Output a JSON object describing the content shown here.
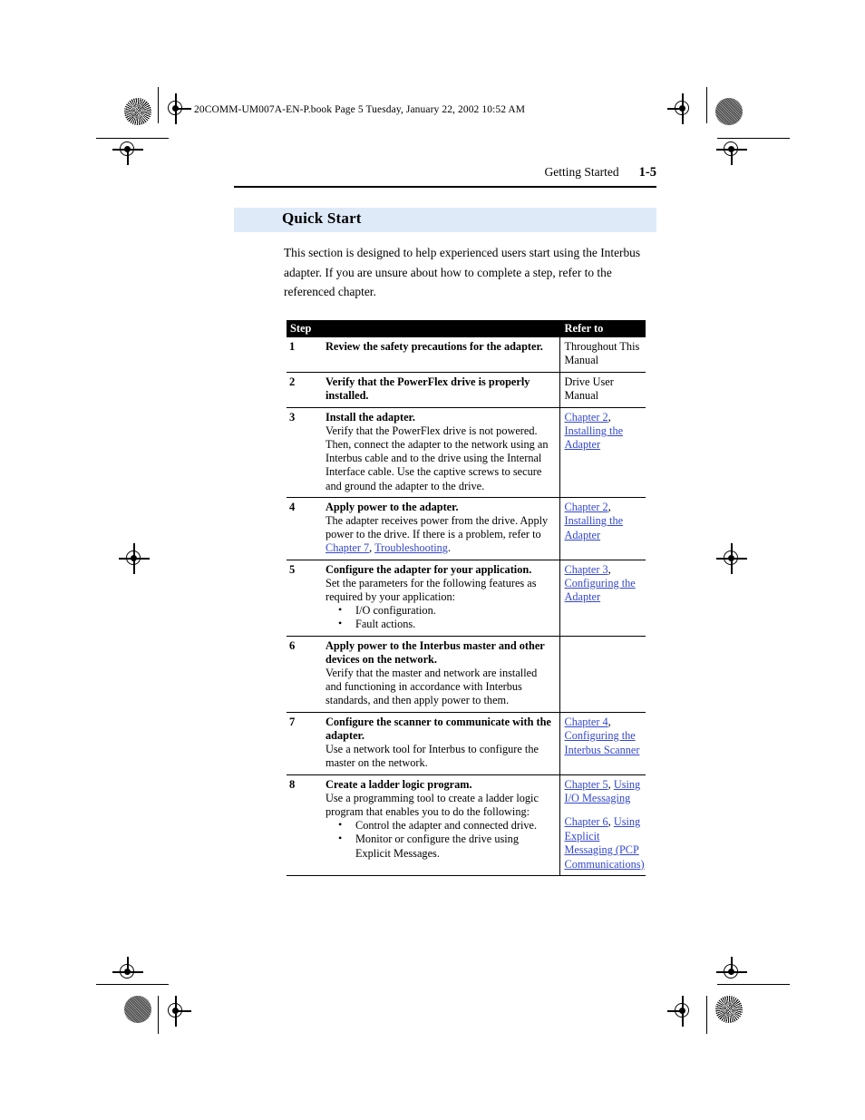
{
  "file_header": "20COMM-UM007A-EN-P.book  Page 5  Tuesday, January 22, 2002  10:52 AM",
  "running_head": {
    "chapter_title": "Getting Started",
    "page_number": "1-5"
  },
  "section": {
    "title": "Quick Start",
    "band_color": "#dfeaf9"
  },
  "intro": "This section is designed to help experienced users start using the Interbus adapter. If you are unsure about how to complete a step, refer to the referenced chapter.",
  "table": {
    "headers": {
      "step": "Step",
      "refer": "Refer to"
    },
    "link_color": "#3347cc",
    "rows": [
      {
        "number": "1",
        "title": "Review the safety precautions for the adapter.",
        "body": "",
        "bullets": [],
        "refer_plain": "Throughout This Manual",
        "refer_links": []
      },
      {
        "number": "2",
        "title": "Verify that the PowerFlex drive is properly installed.",
        "body": "",
        "bullets": [],
        "refer_plain": "Drive User Manual",
        "refer_links": []
      },
      {
        "number": "3",
        "title": "Install the adapter.",
        "body": "Verify that the PowerFlex drive is not powered. Then, connect the adapter to the network using an Interbus cable and to the drive using the Internal Interface cable. Use the captive screws to secure and ground the adapter to the drive.",
        "bullets": [],
        "refer_plain": "",
        "refer_links": [
          "Chapter 2",
          "Installing the Adapter"
        ]
      },
      {
        "number": "4",
        "title": "Apply power to the adapter.",
        "body_part1": "The adapter receives power from the drive. Apply power to the drive. If there is a problem, refer to ",
        "body_link1": "Chapter 7",
        "body_mid": ", ",
        "body_link2": "Troubleshooting",
        "body_end": ".",
        "bullets": [],
        "refer_plain": "",
        "refer_links": [
          "Chapter 2",
          "Installing the Adapter"
        ]
      },
      {
        "number": "5",
        "title": "Configure the adapter for your application.",
        "body": "Set the parameters for the following features as required by your application:",
        "bullets": [
          "I/O configuration.",
          "Fault actions."
        ],
        "refer_plain": "",
        "refer_links": [
          "Chapter 3",
          "Configuring the Adapter"
        ]
      },
      {
        "number": "6",
        "title": "Apply power to the Interbus master and other devices on the network.",
        "body": "Verify that the master and network are installed and functioning in accordance with Interbus standards, and then apply power to them.",
        "bullets": [],
        "refer_plain": "",
        "refer_links": []
      },
      {
        "number": "7",
        "title": "Configure the scanner to communicate with the adapter.",
        "body": "Use a network tool for Interbus to configure the master on the network.",
        "bullets": [],
        "refer_plain": "",
        "refer_links": [
          "Chapter 4",
          "Configuring the Interbus Scanner"
        ]
      },
      {
        "number": "8",
        "title": "Create a ladder logic program.",
        "body": "Use a programming tool to create a ladder logic program that enables you to do the following:",
        "bullets": [
          "Control the adapter and connected drive.",
          "Monitor or configure the drive using Explicit Messages."
        ],
        "refer_plain": "",
        "refer_links": [
          "Chapter 5",
          "Using I/O Messaging",
          "Chapter 6",
          "Using Explicit Messaging (PCP Communications)"
        ]
      }
    ]
  }
}
